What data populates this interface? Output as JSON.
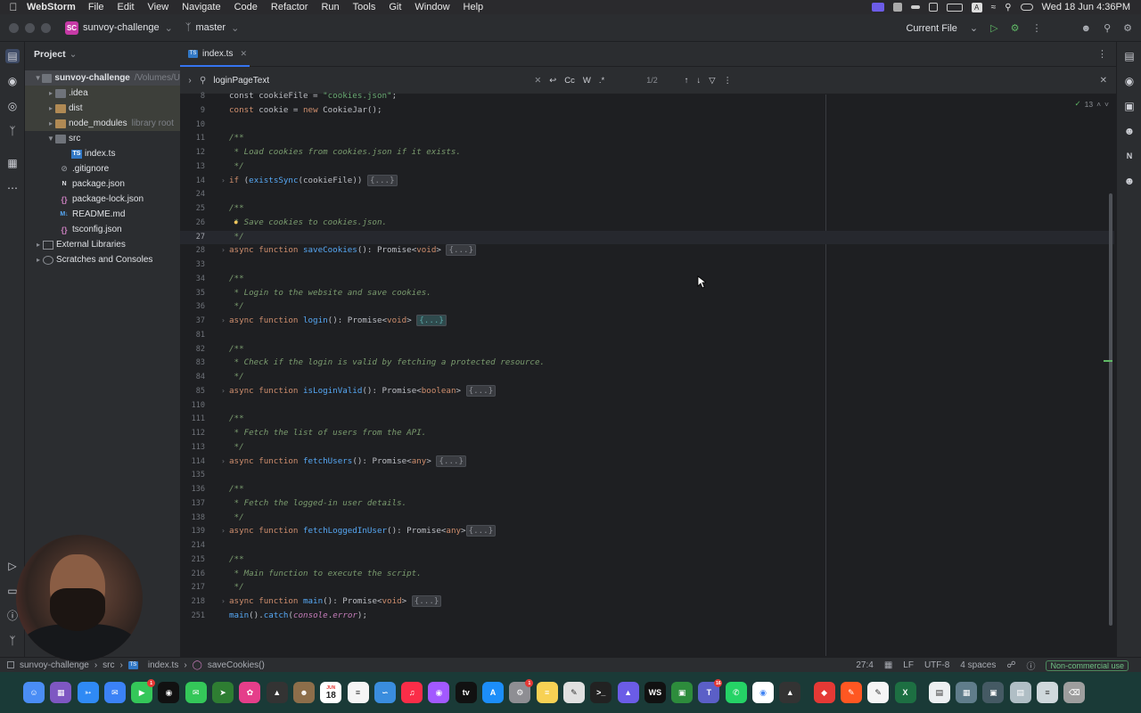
{
  "menubar": {
    "app": "WebStorm",
    "items": [
      "File",
      "Edit",
      "View",
      "Navigate",
      "Code",
      "Refactor",
      "Run",
      "Tools",
      "Git",
      "Window",
      "Help"
    ],
    "clock": "Wed 18 Jun  4:36PM"
  },
  "titlebar": {
    "project_badge": "SC",
    "project": "sunvoy-challenge",
    "branch": "master",
    "run_config": "Current File"
  },
  "project_panel": {
    "title": "Project",
    "tree": [
      {
        "label": "sunvoy-challenge",
        "suffix": "/Volumes/U",
        "kind": "root"
      },
      {
        "label": ".idea",
        "kind": "folder"
      },
      {
        "label": "dist",
        "kind": "folder"
      },
      {
        "label": "node_modules",
        "suffix": "library root",
        "kind": "folder"
      },
      {
        "label": "src",
        "kind": "folder"
      },
      {
        "label": "index.ts",
        "kind": "ts"
      },
      {
        "label": ".gitignore",
        "kind": "file"
      },
      {
        "label": "package.json",
        "kind": "json"
      },
      {
        "label": "package-lock.json",
        "kind": "json"
      },
      {
        "label": "README.md",
        "kind": "md"
      },
      {
        "label": "tsconfig.json",
        "kind": "json"
      },
      {
        "label": "External Libraries",
        "kind": "lib"
      },
      {
        "label": "Scratches and Consoles",
        "kind": "lib"
      }
    ]
  },
  "editor": {
    "tab": "index.ts",
    "find": {
      "query": "loginPageText",
      "opts": [
        "Cc",
        "W",
        ".*"
      ],
      "count": "1/2"
    },
    "inspections": "13",
    "lines": [
      {
        "n": "8",
        "parts": [
          [
            "",
            "const cookieFile = "
          ],
          [
            "str",
            "\"cookies.json\""
          ],
          [
            "",
            ";"
          ]
        ]
      },
      {
        "n": "9",
        "parts": [
          [
            "kw",
            "const "
          ],
          [
            "",
            "cookie = "
          ],
          [
            "kw",
            "new "
          ],
          [
            "",
            "CookieJar();"
          ]
        ]
      },
      {
        "n": "10",
        "parts": []
      },
      {
        "n": "11",
        "parts": [
          [
            "cmt",
            "/**"
          ]
        ]
      },
      {
        "n": "12",
        "parts": [
          [
            "cmt",
            " * Load cookies from cookies.json if it exists."
          ]
        ]
      },
      {
        "n": "13",
        "parts": [
          [
            "cmt",
            " */"
          ]
        ]
      },
      {
        "n": "14",
        "parts": [
          [
            "kw",
            "if "
          ],
          [
            "",
            "("
          ],
          [
            "fn",
            "existsSync"
          ],
          [
            "",
            "(cookieFile)) "
          ],
          [
            "ph",
            "{...}"
          ]
        ]
      },
      {
        "n": "24",
        "parts": []
      },
      {
        "n": "25",
        "parts": [
          [
            "cmt",
            "/**"
          ]
        ]
      },
      {
        "n": "26",
        "parts": [
          [
            "cmt",
            " * Save cookies to cookies.json."
          ]
        ]
      },
      {
        "n": "27",
        "parts": [
          [
            "cmt",
            " */"
          ]
        ]
      },
      {
        "n": "28",
        "parts": [
          [
            "kw",
            "async function "
          ],
          [
            "fn",
            "saveCookies"
          ],
          [
            "",
            "(): Promise<"
          ],
          [
            "kw",
            "void"
          ],
          [
            "",
            "> "
          ],
          [
            "ph",
            "{...}"
          ]
        ]
      },
      {
        "n": "33",
        "parts": []
      },
      {
        "n": "34",
        "parts": [
          [
            "cmt",
            "/**"
          ]
        ]
      },
      {
        "n": "35",
        "parts": [
          [
            "cmt",
            " * Login to the website and save cookies."
          ]
        ]
      },
      {
        "n": "36",
        "parts": [
          [
            "cmt",
            " */"
          ]
        ]
      },
      {
        "n": "37",
        "parts": [
          [
            "kw",
            "async function "
          ],
          [
            "fn",
            "login"
          ],
          [
            "",
            "(): Promise<"
          ],
          [
            "kw",
            "void"
          ],
          [
            "",
            "> "
          ],
          [
            "phhl",
            "{...}"
          ]
        ]
      },
      {
        "n": "81",
        "parts": []
      },
      {
        "n": "82",
        "parts": [
          [
            "cmt",
            "/**"
          ]
        ]
      },
      {
        "n": "83",
        "parts": [
          [
            "cmt",
            " * Check if the login is valid by fetching a protected resource."
          ]
        ]
      },
      {
        "n": "84",
        "parts": [
          [
            "cmt",
            " */"
          ]
        ]
      },
      {
        "n": "85",
        "parts": [
          [
            "kw",
            "async function "
          ],
          [
            "fn",
            "isLoginValid"
          ],
          [
            "",
            "(): Promise<"
          ],
          [
            "kw",
            "boolean"
          ],
          [
            "",
            "> "
          ],
          [
            "ph",
            "{...}"
          ]
        ]
      },
      {
        "n": "110",
        "parts": []
      },
      {
        "n": "111",
        "parts": [
          [
            "cmt",
            "/**"
          ]
        ]
      },
      {
        "n": "112",
        "parts": [
          [
            "cmt",
            " * Fetch the list of users from the API."
          ]
        ]
      },
      {
        "n": "113",
        "parts": [
          [
            "cmt",
            " */"
          ]
        ]
      },
      {
        "n": "114",
        "parts": [
          [
            "kw",
            "async function "
          ],
          [
            "fn",
            "fetchUsers"
          ],
          [
            "",
            "(): Promise<"
          ],
          [
            "kw",
            "any"
          ],
          [
            "",
            "> "
          ],
          [
            "ph",
            "{...}"
          ]
        ]
      },
      {
        "n": "135",
        "parts": []
      },
      {
        "n": "136",
        "parts": [
          [
            "cmt",
            "/**"
          ]
        ]
      },
      {
        "n": "137",
        "parts": [
          [
            "cmt",
            " * Fetch the logged-in user details."
          ]
        ]
      },
      {
        "n": "138",
        "parts": [
          [
            "cmt",
            " */"
          ]
        ]
      },
      {
        "n": "139",
        "parts": [
          [
            "kw",
            "async function "
          ],
          [
            "fn",
            "fetchLoggedInUser"
          ],
          [
            "",
            "(): Promise<"
          ],
          [
            "kw",
            "any"
          ],
          [
            "",
            ">"
          ],
          [
            "ph",
            "{...}"
          ]
        ]
      },
      {
        "n": "214",
        "parts": []
      },
      {
        "n": "215",
        "parts": [
          [
            "cmt",
            "/**"
          ]
        ]
      },
      {
        "n": "216",
        "parts": [
          [
            "cmt",
            " * Main function to execute the script."
          ]
        ]
      },
      {
        "n": "217",
        "parts": [
          [
            "cmt",
            " */"
          ]
        ]
      },
      {
        "n": "218",
        "parts": [
          [
            "kw",
            "async function "
          ],
          [
            "fn",
            "main"
          ],
          [
            "",
            "(): Promise<"
          ],
          [
            "kw",
            "void"
          ],
          [
            "",
            "> "
          ],
          [
            "ph",
            "{...}"
          ]
        ]
      },
      {
        "n": "251",
        "parts": [
          [
            "fn",
            "main"
          ],
          [
            "",
            "()."
          ],
          [
            "fn",
            "catch"
          ],
          [
            "",
            "("
          ],
          [
            "ip",
            "console"
          ],
          [
            "",
            "."
          ],
          [
            "ip",
            "error"
          ],
          [
            "",
            ");"
          ]
        ]
      }
    ]
  },
  "statusbar": {
    "crumbs": [
      "sunvoy-challenge",
      "src",
      "index.ts",
      "saveCookies()"
    ],
    "position": "27:4",
    "line_sep": "LF",
    "encoding": "UTF-8",
    "indent": "4 spaces",
    "license": "Non-commercial use"
  },
  "dock": {
    "calendar_day": "18",
    "calendar_month": "JUN",
    "badge_messages": "1",
    "badge_settings": "1",
    "badge_teams": "16"
  },
  "colors": {
    "accent": "#3574f0",
    "editor_bg": "#1e1f22",
    "panel_bg": "#2b2d30",
    "keyword": "#cf8e6d",
    "function": "#56a8f5",
    "comment": "#7a9b6e"
  }
}
